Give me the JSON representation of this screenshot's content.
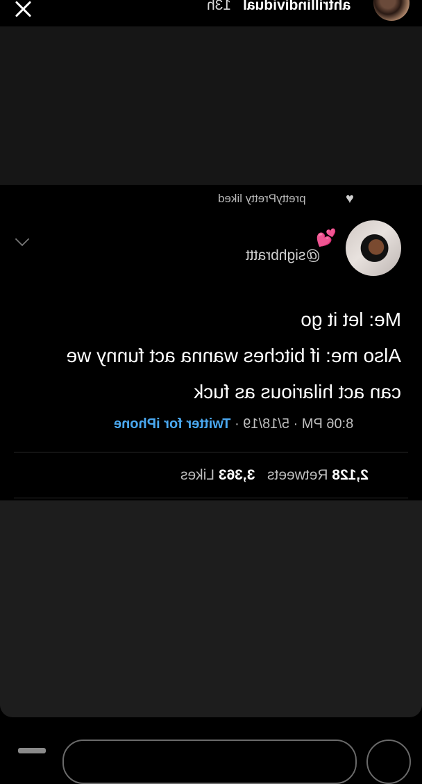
{
  "story": {
    "username": "ahtrillindividual",
    "time_ago": "13h"
  },
  "tweet": {
    "social_context": "prettyPretty liked",
    "handle": "@sighbrattt",
    "emoji": "💕",
    "text_lines": [
      "Me: let it go",
      "Also me: if bitches wanna act funny we",
      "can act hilarious as fuck"
    ],
    "time": "8:06 PM",
    "date": "5/18/19",
    "source": "Twitter for iPhone",
    "retweets_count": "2,128",
    "retweets_label": "Retweets",
    "likes_count": "3,363",
    "likes_label": "Likes"
  },
  "colors": {
    "link": "#4aa8f0",
    "background": "#000000",
    "dim_panel": "#1d1d1d"
  },
  "icons": {
    "close": "close-icon",
    "liked": "heart-icon",
    "menu": "chevron-down-icon"
  }
}
